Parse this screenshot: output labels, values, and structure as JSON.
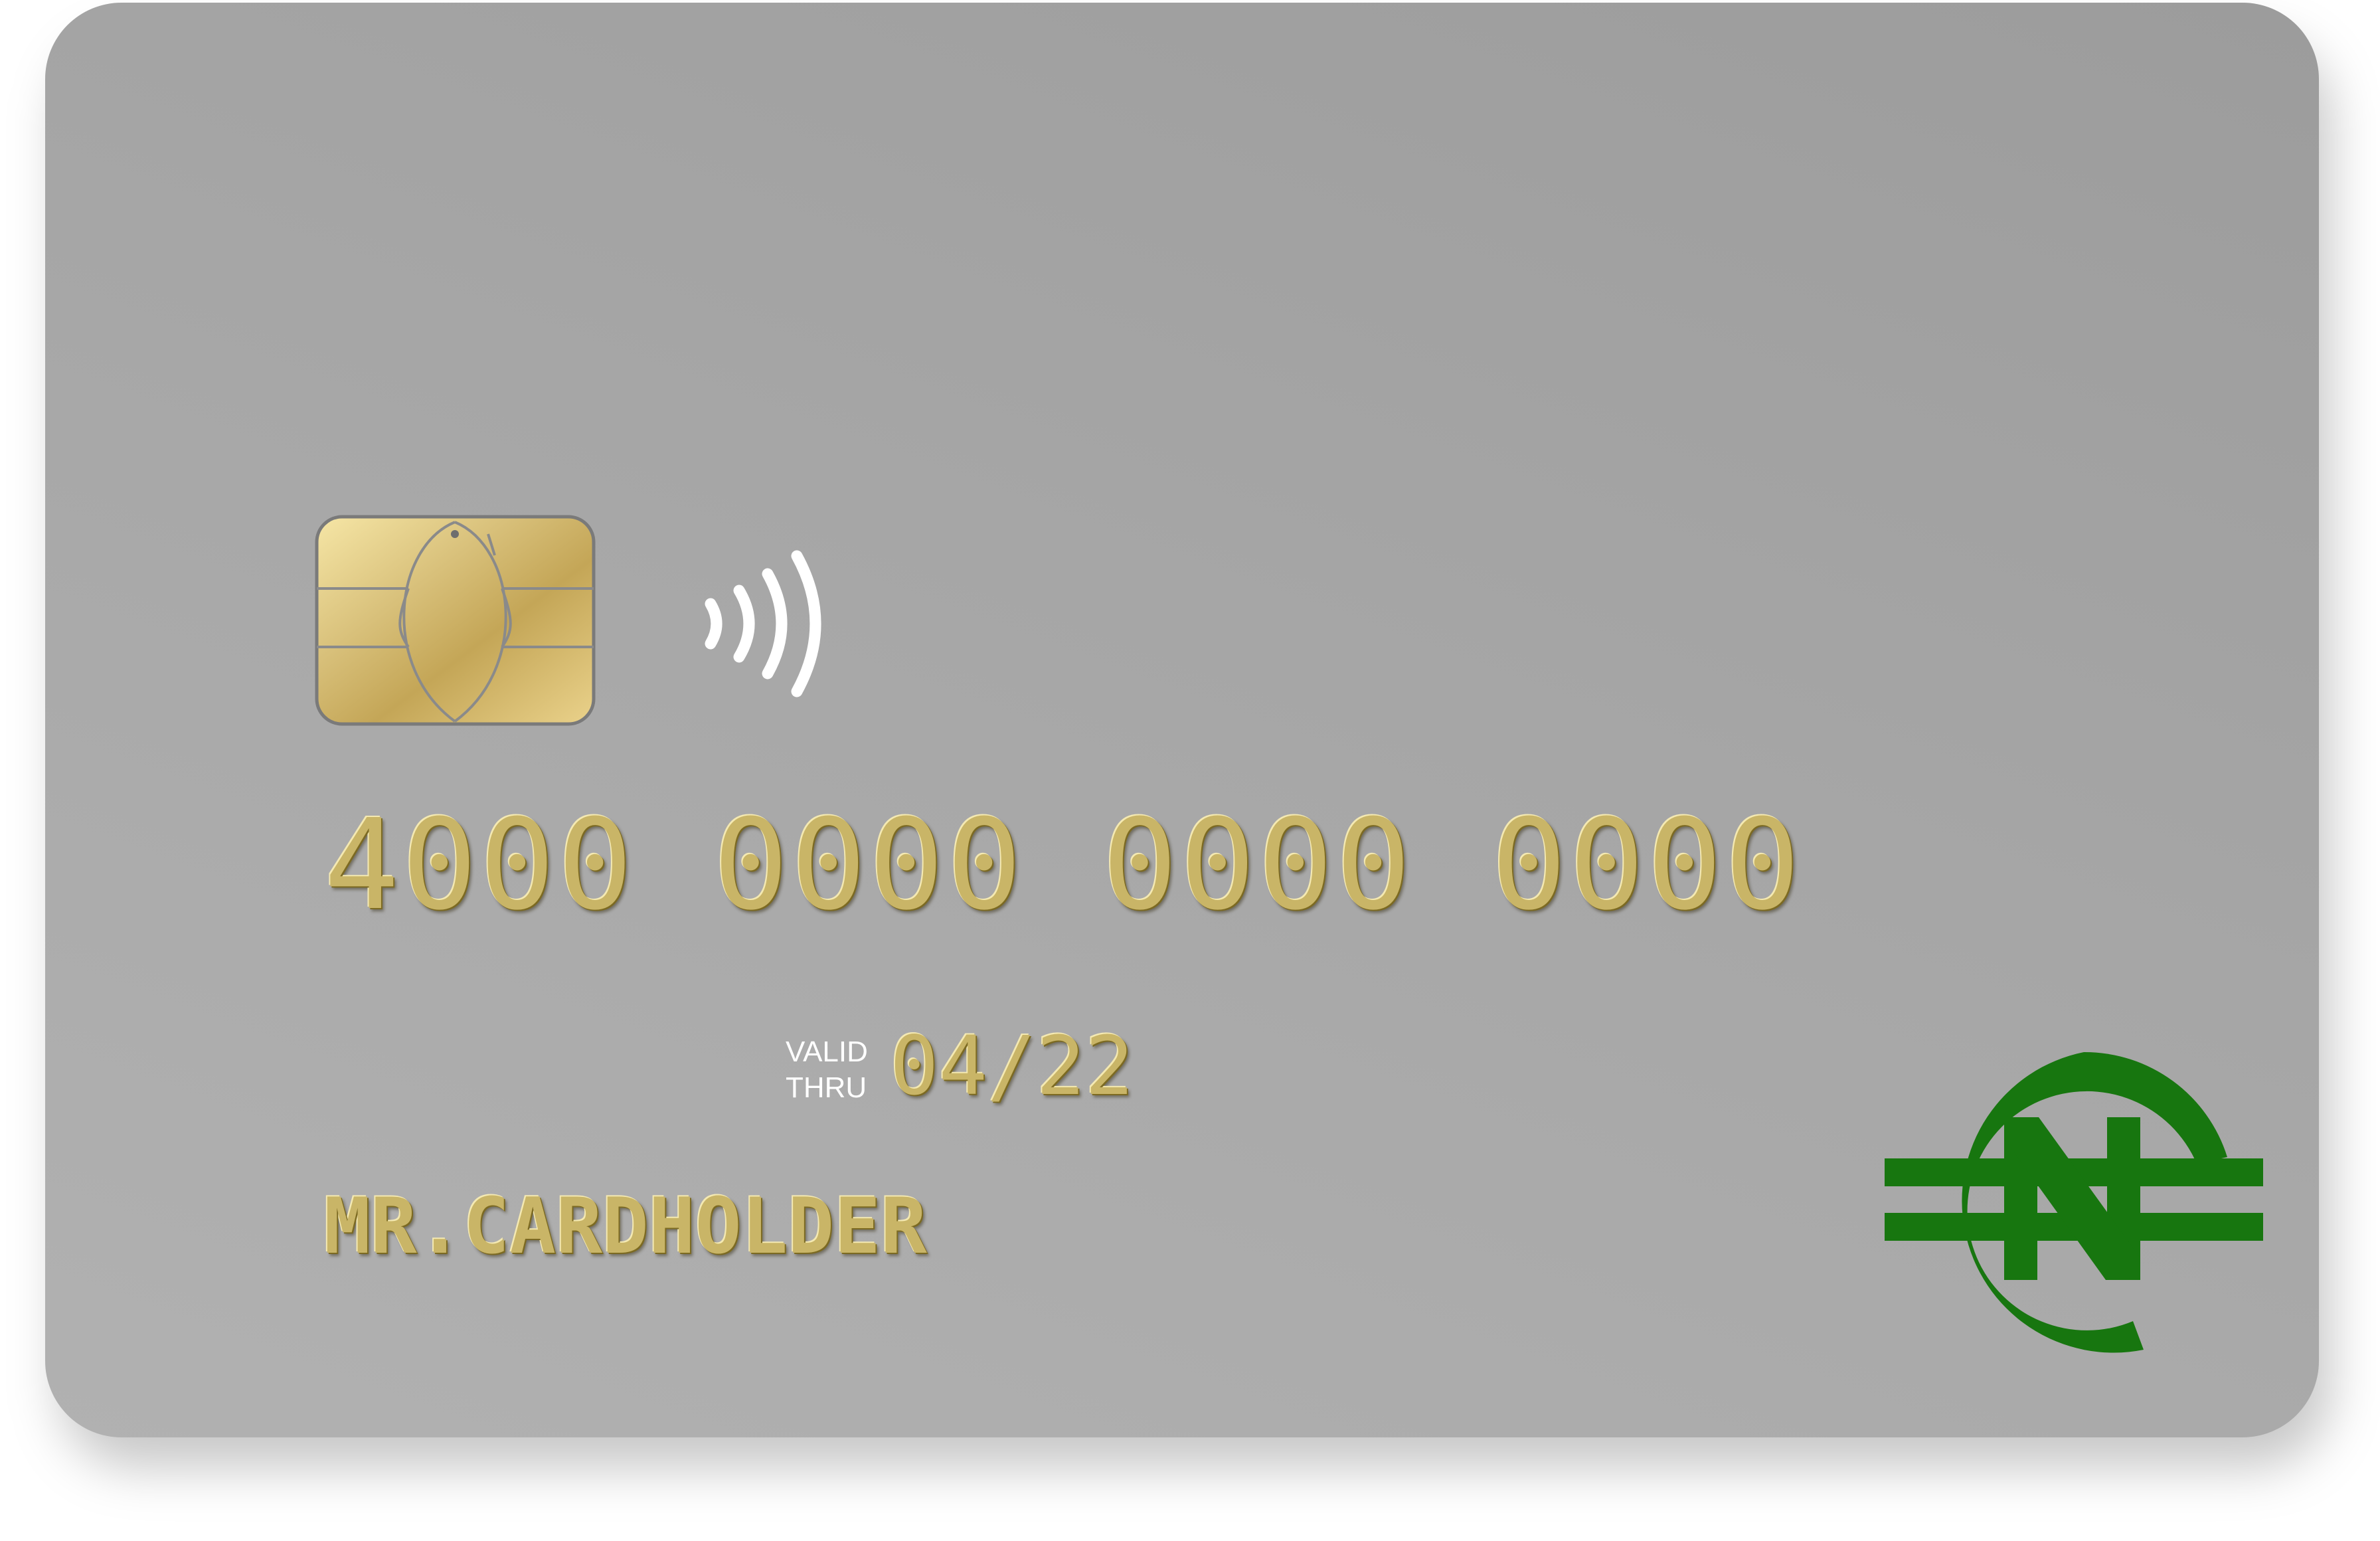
{
  "card": {
    "number": "4000 0000 0000 0000",
    "valid_line1": "VALID",
    "valid_line2": "THRU",
    "expiry": "04/22",
    "holder": "MR.CARDHOLDER"
  },
  "icons": {
    "chip": "emv-chip-icon",
    "contactless": "contactless-icon",
    "brand": "naira-currency-logo"
  },
  "colors": {
    "card_top": "#9c9c9c",
    "card_bottom": "#b1b1b1",
    "emboss_gold": "#c9b567",
    "brand_green": "#17760f",
    "label_white": "#ffffff"
  }
}
